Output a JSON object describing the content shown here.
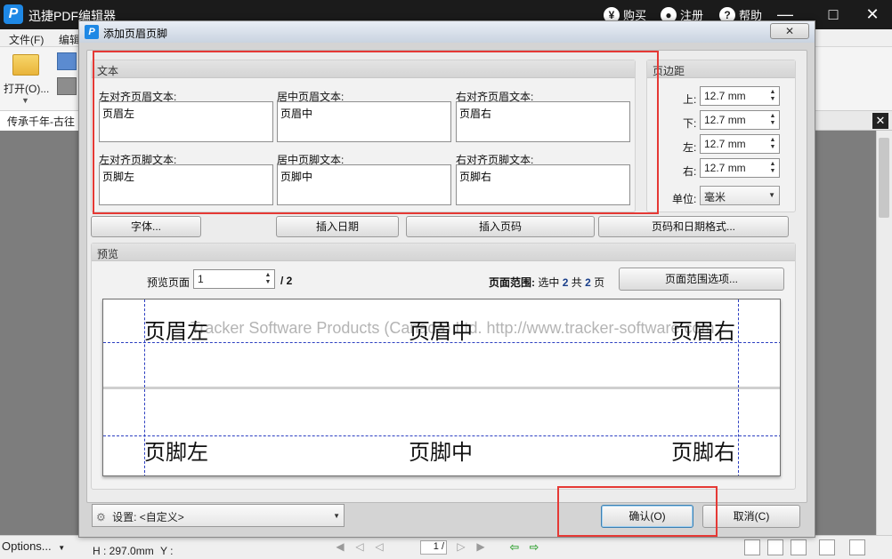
{
  "app": {
    "title": "迅捷PDF编辑器",
    "logo_letter": "P",
    "buy_label": "购买",
    "buy_icon_glyph": "¥",
    "register_label": "注册",
    "help_label": "帮助",
    "help_icon_glyph": "?"
  },
  "menubar": {
    "file": "文件(F)",
    "edit": "编辑"
  },
  "toolbar": {
    "open_label": "打开(O)..."
  },
  "document_tab": {
    "label": "传承千年-古往"
  },
  "statusbar": {
    "options_label": "Options...",
    "height_label": "H : 297.0mm",
    "y_label": "Y :",
    "page_value": "1 /"
  },
  "dialog": {
    "title": "添加页眉页脚",
    "icon_letter": "P",
    "close_glyph": "✕",
    "text_group": {
      "title": "文本",
      "left_header_label": "左对齐页眉文本:",
      "left_header_value": "页眉左",
      "center_header_label": "居中页眉文本:",
      "center_header_value": "页眉中",
      "right_header_label": "右对齐页眉文本:",
      "right_header_value": "页眉右",
      "left_footer_label": "左对齐页脚文本:",
      "left_footer_value": "页脚左",
      "center_footer_label": "居中页脚文本:",
      "center_footer_value": "页脚中",
      "right_footer_label": "右对齐页脚文本:",
      "right_footer_value": "页脚右"
    },
    "margins": {
      "title": "页边距",
      "top_label": "上:",
      "top_value": "12.7 mm",
      "bottom_label": "下:",
      "bottom_value": "12.7 mm",
      "left_label": "左:",
      "left_value": "12.7 mm",
      "right_label": "右:",
      "right_value": "12.7 mm",
      "unit_label": "单位:",
      "unit_value": "毫米"
    },
    "buttons": {
      "font": "字体...",
      "insert_date": "插入日期",
      "insert_page": "插入页码",
      "page_date_format": "页码和日期格式...",
      "page_range_options": "页面范围选项...",
      "ok": "确认(O)",
      "cancel": "取消(C)"
    },
    "preview": {
      "title": "预览",
      "page_label": "预览页面",
      "page_value": "1",
      "page_total": "/ 2",
      "range_label": "页面范围:",
      "range_text_1": "选中",
      "range_selected": "2",
      "range_text_2": "共",
      "range_total": "2",
      "range_text_3": "页",
      "header_left": "页眉左",
      "header_center": "页眉中",
      "header_right": "页眉右",
      "footer_left": "页脚左",
      "footer_center": "页脚中",
      "footer_right": "页脚右",
      "watermark": "Tracker Software Products (Canada) Ltd.   http://www.tracker-software.com"
    },
    "settings": {
      "label": "设置:",
      "value": "<自定义>"
    }
  },
  "colors": {
    "highlight_box": "#e53935",
    "guide_line": "#2c3fc1",
    "titlebar_bg": "#1b1b1b"
  }
}
